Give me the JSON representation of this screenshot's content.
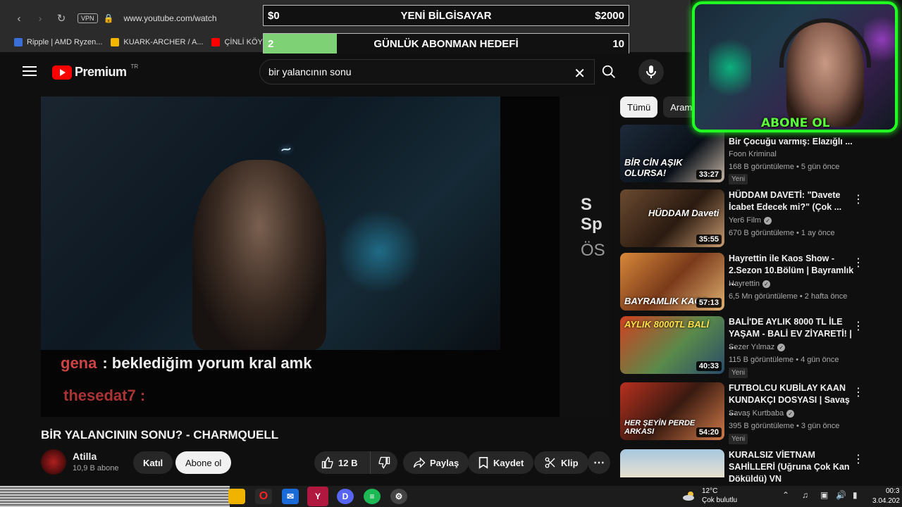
{
  "browser": {
    "url": "www.youtube.com/watch",
    "vpn_label": "VPN",
    "bookmarks": [
      {
        "label": "Ripple | AMD Ryzen...",
        "color": "#3b6fd8"
      },
      {
        "label": "KUARK-ARCHER / A...",
        "color": "#f4b400"
      },
      {
        "label": "ÇİNLİ KÖYE GİR",
        "color": "#ff0000"
      }
    ]
  },
  "goals": {
    "computer": {
      "left": "$0",
      "title": "YENİ BİLGİSAYAR",
      "right": "$2000",
      "progress": 0
    },
    "subscribers": {
      "left": "2",
      "title": "GÜNLÜK ABONMAN HEDEFİ",
      "right": "10",
      "progress": 0.2
    }
  },
  "youtube": {
    "logo_text": "Premium",
    "region": "TR",
    "search_value": "bir yalancının sonu"
  },
  "video": {
    "overlay_chat_user": "gena",
    "overlay_chat_text": ": beklediğim yorum kral amk",
    "overlay_chat_user2": "thesedat7 :",
    "side_text_1": "S Sp",
    "side_text_2": "ÖS",
    "title": "BİR YALANCININ SONU? - CHARMQUELL",
    "channel": "Atilla",
    "subscribers": "10,9 B abone",
    "join_label": "Katıl",
    "subscribe_label": "Abone ol",
    "likes": "12 B",
    "share_label": "Paylaş",
    "save_label": "Kaydet",
    "clip_label": "Klip"
  },
  "sidebar": {
    "chips": [
      "Tümü",
      "Aram"
    ],
    "recommendations": [
      {
        "title": "Bir Çocuğu varmış: Elazığlı ...",
        "channel": "Foon Kriminal",
        "verified": false,
        "meta": "168 B görüntüleme • 5 gün önce",
        "badge": "Yeni",
        "duration": "33:27",
        "caption": "BİR CİN AŞIK OLURSA!",
        "thumb_color": "#1d2a3a"
      },
      {
        "title": "HÜDDAM DAVETİ: \"Davete İcabet Edecek mi?\" (Çok ...",
        "channel": "Yer6 Film",
        "verified": true,
        "meta": "670 B görüntüleme • 1 ay önce",
        "badge": "",
        "duration": "35:55",
        "caption": "HÜDDAM Daveti",
        "thumb_color": "#4a3020"
      },
      {
        "title": "Hayrettin ile Kaos Show - 2.Sezon 10.Bölüm | Bayramlık ...",
        "channel": "Hayrettin",
        "verified": true,
        "meta": "6,5 Mn görüntüleme • 2 hafta önce",
        "badge": "",
        "duration": "57:13",
        "caption": "BAYRAMLIK KAOS",
        "thumb_color": "#b86a2a"
      },
      {
        "title": "BALİ'DE AYLIK 8000 TL İLE YAŞAM - BALİ EV ZİYARETİ! | ...",
        "channel": "Sezer Yılmaz",
        "verified": true,
        "meta": "115 B görüntüleme • 4 gün önce",
        "badge": "Yeni",
        "duration": "40:33",
        "caption": "AYLIK 8000TL BALİ",
        "thumb_color": "#3a6a3a"
      },
      {
        "title": "FUTBOLCU KUBİLAY KAAN KUNDAKÇI DOSYASI | Savaş ...",
        "channel": "Savaş Kurtbaba",
        "verified": true,
        "meta": "395 B görüntüleme • 3 gün önce",
        "badge": "Yeni",
        "duration": "54:20",
        "caption": "HER ŞEYİN PERDE ARKASI",
        "thumb_color": "#8a2a1a"
      },
      {
        "title": "KURALSIZ VİETNAM SAHİLLERİ (Uğruna Çok Kan Döküldü) VN",
        "channel": "",
        "verified": false,
        "meta": "",
        "badge": "",
        "duration": "",
        "caption": "",
        "thumb_color": "#6a8aa0"
      }
    ]
  },
  "webcam": {
    "overlay_text": "ABONE OL"
  },
  "taskbar": {
    "temperature": "12°C",
    "weather": "Çok bulutlu",
    "time": "00:3",
    "date": "3.04.202"
  }
}
